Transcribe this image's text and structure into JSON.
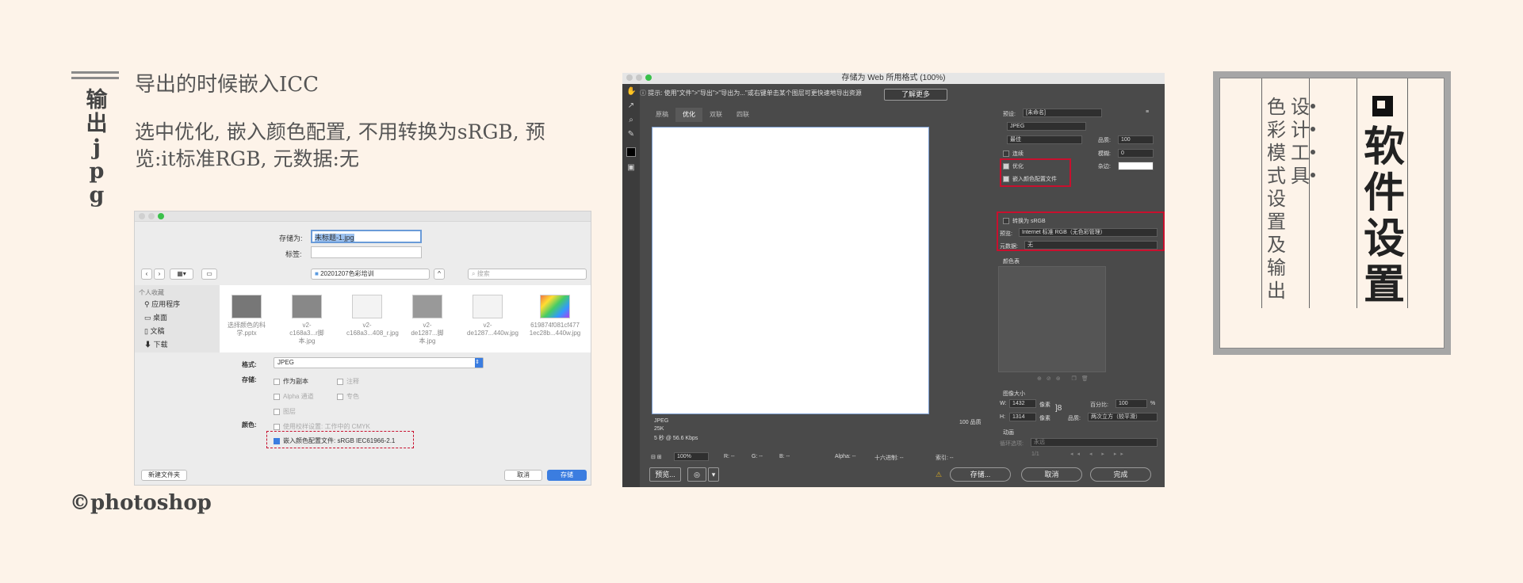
{
  "left_panel": {
    "vertical_title": [
      "输",
      "出",
      "j",
      "p",
      "g"
    ],
    "heading": "导出的时候嵌入ICC",
    "paragraph": "选中优化, 嵌入颜色配置, 不用转换为sRGB, 预览:it标准RGB, 元数据:无",
    "footer": "©photoshop"
  },
  "mac_dialog": {
    "save_as_label": "存储为:",
    "save_as_value": "未标题-1.jpg",
    "tags_label": "标签:",
    "folder": "20201207色彩培训",
    "search_placeholder": "搜索",
    "sidebar_header": "个人收藏",
    "sidebar_items": [
      "应用程序",
      "桌面",
      "文稿",
      "下载"
    ],
    "thumbnails": [
      {
        "line1": "选择颜色的科",
        "line2": "学.pptx"
      },
      {
        "line1": "v2-",
        "line2": "c168a3...r脚本.jpg"
      },
      {
        "line1": "v2-",
        "line2": "c168a3...408_r.jpg"
      },
      {
        "line1": "v2-",
        "line2": "de1287...脚本.jpg"
      },
      {
        "line1": "v2-",
        "line2": "de1287...440w.jpg"
      },
      {
        "line1": "619874f081cf477",
        "line2": "1ec28b...440w.jpg"
      }
    ],
    "format_label": "格式:",
    "format_value": "JPEG",
    "save_label": "存储:",
    "opt_copy": "作为副本",
    "opt_notes": "注释",
    "opt_alpha": "Alpha 通道",
    "opt_spot": "专色",
    "opt_layers": "图层",
    "color_label": "颜色:",
    "opt_proof": "使用校样设置: 工作中的 CMYK",
    "opt_embed": "嵌入颜色配置文件: sRGB IEC61966-2.1",
    "new_folder": "新建文件夹",
    "cancel": "取消",
    "save": "存储"
  },
  "ps_dialog": {
    "title": "存储为 Web 所用格式 (100%)",
    "hint": "提示: 使用\"文件\">\"导出\">\"导出为...\"或右键单击某个图层可更快速地导出资源",
    "learn_more": "了解更多",
    "tabs": [
      "原稿",
      "优化",
      "双联",
      "四联"
    ],
    "preset_label": "预设:",
    "preset_value": "[未命名]",
    "format_value": "JPEG",
    "quality_mode": "最佳",
    "quality_label": "品质:",
    "quality_value": "100",
    "progressive": "连续",
    "blur_label": "模糊:",
    "blur_value": "0",
    "optimized": "优化",
    "matte_label": "杂边:",
    "embed_profile": "嵌入颜色配置文件",
    "convert_srgb": "转换为 sRGB",
    "preview_label": "预览:",
    "preview_value": "Internet 标准 RGB（无色彩管理）",
    "metadata_label": "元数据:",
    "metadata_value": "无",
    "color_table": "颜色表",
    "image_size": "图像大小",
    "w_label": "W:",
    "w_value": "1432",
    "h_label": "H:",
    "h_value": "1314",
    "px": "像素",
    "percent_label": "百分比:",
    "percent_value": "100",
    "percent_unit": "%",
    "quality2_label": "品质:",
    "quality2_value": "两次立方（较平滑）",
    "animation": "动画",
    "loop_label": "循环选项:",
    "loop_value": "永远",
    "frame": "1/1",
    "info_format": "JPEG",
    "info_size": "25K",
    "info_time": "5 秒 @ 56.6 Kbps",
    "info_quality": "100 品质",
    "zoom": "100%",
    "r": "R: --",
    "g": "G: --",
    "b": "B: --",
    "alpha": "Alpha: --",
    "hex": "十六进制: --",
    "index": "索引: --",
    "preview_btn": "预览...",
    "save_btn": "存储...",
    "cancel_btn": "取消",
    "done_btn": "完成"
  },
  "right_card": {
    "col1": [
      "色",
      "彩",
      "模",
      "式",
      "设",
      "置",
      "及",
      "输",
      "出"
    ],
    "col2": [
      "设",
      "计",
      "工",
      "具"
    ],
    "big": [
      "软",
      "件",
      "设",
      "置"
    ]
  }
}
